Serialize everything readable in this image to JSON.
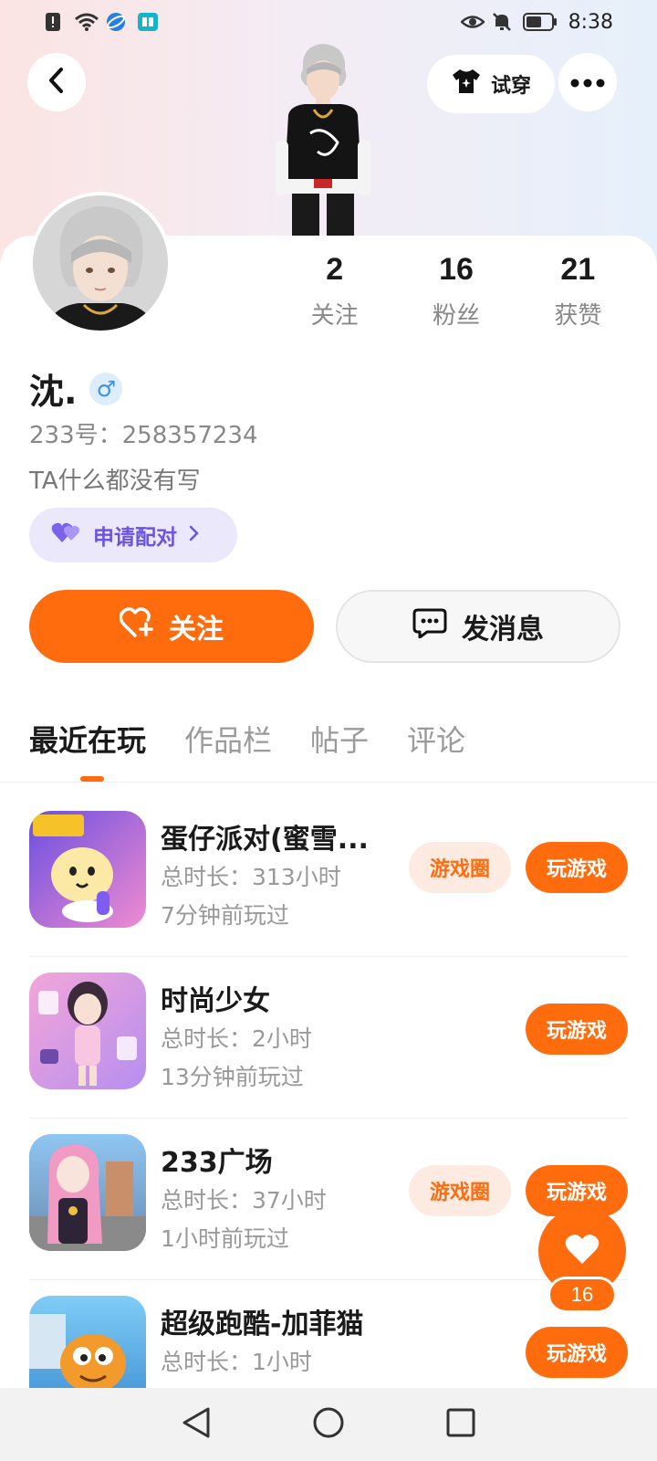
{
  "status_bar": {
    "time": "8:38",
    "icons": [
      "notification-icon",
      "wifi-icon",
      "browser-icon",
      "reader-icon",
      "eye-icon",
      "mute-icon",
      "battery-icon"
    ]
  },
  "header": {
    "tryon_label": "试穿"
  },
  "profile": {
    "stats": [
      {
        "value": "2",
        "label": "关注"
      },
      {
        "value": "16",
        "label": "粉丝"
      },
      {
        "value": "21",
        "label": "获赞"
      }
    ],
    "name": "沈.",
    "gender_symbol": "♂",
    "id_line": "233号：258357234",
    "bio": "TA什么都没有写",
    "pair_label": "申请配对"
  },
  "actions": {
    "follow_label": "关注",
    "message_label": "发消息"
  },
  "tabs": [
    "最近在玩",
    "作品栏",
    "帖子",
    "评论"
  ],
  "games": [
    {
      "title": "蛋仔派对(蜜雪...",
      "total": "总时长：313小时",
      "last": "7分钟前玩过",
      "circle": "游戏圈",
      "play": "玩游戏"
    },
    {
      "title": "时尚少女",
      "total": "总时长：2小时",
      "last": "13分钟前玩过",
      "circle": "",
      "play": "玩游戏"
    },
    {
      "title": "233广场",
      "total": "总时长：37小时",
      "last": "1小时前玩过",
      "circle": "游戏圈",
      "play": "玩游戏"
    },
    {
      "title": "超级跑酷-加菲猫",
      "total": "总时长：1小时",
      "last": "",
      "circle": "",
      "play": "玩游戏"
    }
  ],
  "fab": {
    "count": "16"
  },
  "colors": {
    "accent": "#ff6c0e",
    "pair": "#6a54e0",
    "chip_bg": "#fdebe1"
  }
}
